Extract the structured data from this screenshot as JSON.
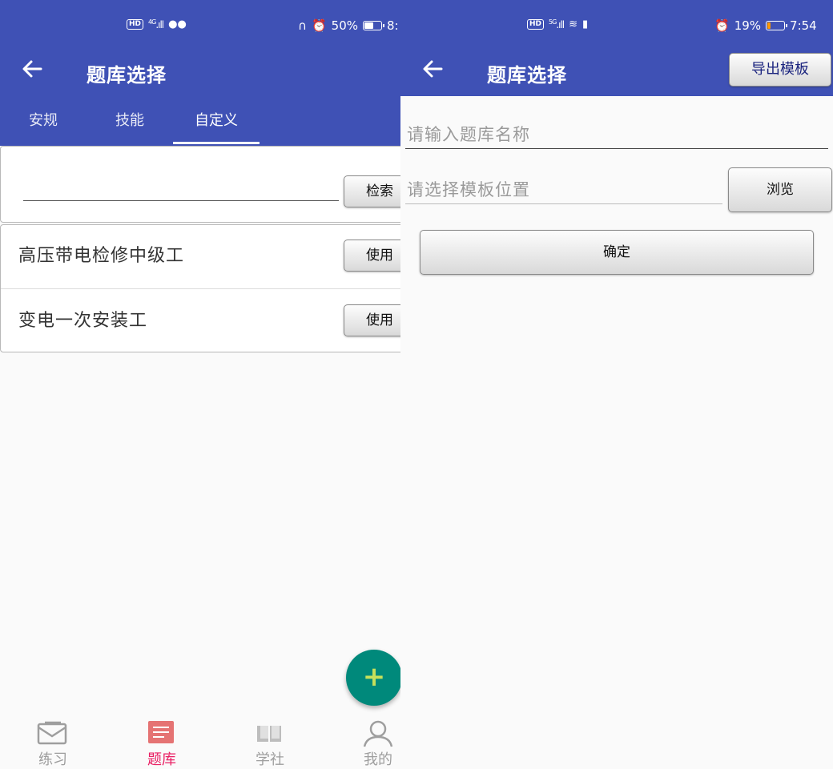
{
  "left": {
    "status": {
      "hd": "HD",
      "net": "4G",
      "battery_text": "50%",
      "time": "8:",
      "battery_level": 0.5
    },
    "appbar": {
      "back_icon": "arrow-left-icon",
      "title": "题库选择"
    },
    "tabs": [
      {
        "label": "安规"
      },
      {
        "label": "技能"
      },
      {
        "label": "自定义"
      }
    ],
    "search": {
      "value": "",
      "button": "检索"
    },
    "list": [
      {
        "name": "高压带电检修中级工",
        "action": "使用"
      },
      {
        "name": "变电一次安装工",
        "action": "使用"
      }
    ],
    "fab": {
      "label": "+",
      "icon": "plus-icon"
    },
    "nav": [
      {
        "label": "练习",
        "icon": "envelope-icon"
      },
      {
        "label": "题库",
        "icon": "list-icon"
      },
      {
        "label": "学社",
        "icon": "book-icon"
      },
      {
        "label": "我的",
        "icon": "person-icon"
      }
    ],
    "colors": {
      "primary": "#3f51b5",
      "accent": "#e91e63",
      "fab": "#00897b"
    }
  },
  "right": {
    "status": {
      "hd": "HD",
      "net": "5G",
      "battery_text": "19%",
      "time": "7:54",
      "battery_level": 0.19
    },
    "appbar": {
      "back_icon": "arrow-left-icon",
      "title": "题库选择",
      "export_button": "导出模板"
    },
    "form": {
      "name_placeholder": "请输入题库名称",
      "template_placeholder": "请选择模板位置",
      "browse_button": "浏览",
      "confirm_button": "确定"
    }
  }
}
